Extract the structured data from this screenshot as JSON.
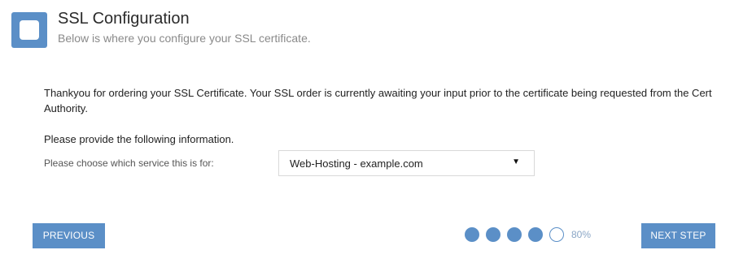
{
  "header": {
    "title": "SSL Configuration",
    "subtitle": "Below is where you configure your SSL certificate."
  },
  "intro_text": "Thankyou for ordering your SSL Certificate. Your SSL order is currently awaiting your input prior to the certificate being requested from the Cert Authority.",
  "provide_text": "Please provide the following information.",
  "service_field": {
    "label": "Please choose which service this is for:",
    "selected": "Web-Hosting - example.com",
    "arrow": "▼"
  },
  "footer": {
    "previous_label": "PREVIOUS",
    "next_label": "NEXT STEP",
    "progress_steps_total": 5,
    "progress_steps_complete": 4,
    "progress_percent": "80%"
  },
  "colors": {
    "accent": "#5b8fc7"
  }
}
